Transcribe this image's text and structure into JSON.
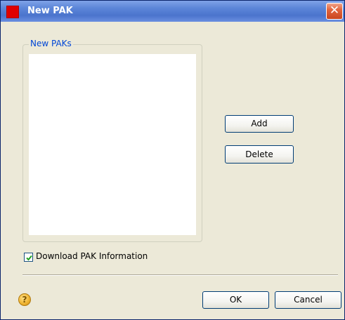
{
  "window": {
    "title": "New PAK",
    "close_glyph": "✕",
    "icon": "app-icon",
    "accent_color": "#e00000"
  },
  "group": {
    "legend": "New PAKs",
    "list_items": []
  },
  "buttons": {
    "add_label": "Add",
    "delete_label": "Delete",
    "ok_label": "OK",
    "cancel_label": "Cancel"
  },
  "options": {
    "download_label": "Download PAK Information",
    "download_checked": true
  },
  "help": {
    "glyph": "?",
    "icon": "help-icon"
  }
}
